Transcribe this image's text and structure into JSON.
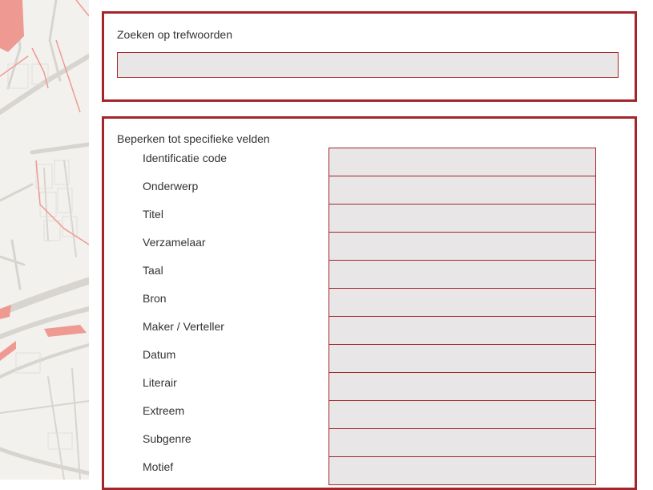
{
  "keyword_search": {
    "title": "Zoeken op trefwoorden",
    "value": ""
  },
  "field_search": {
    "title": "Beperken tot specifieke velden",
    "fields": [
      {
        "label": "Identificatie code",
        "value": ""
      },
      {
        "label": "Onderwerp",
        "value": ""
      },
      {
        "label": "Titel",
        "value": ""
      },
      {
        "label": "Verzamelaar",
        "value": ""
      },
      {
        "label": "Taal",
        "value": ""
      },
      {
        "label": "Bron",
        "value": ""
      },
      {
        "label": "Maker / Verteller",
        "value": ""
      },
      {
        "label": "Datum",
        "value": ""
      },
      {
        "label": "Literair",
        "value": ""
      },
      {
        "label": "Extreem",
        "value": ""
      },
      {
        "label": "Subgenre",
        "value": ""
      },
      {
        "label": "Motief",
        "value": ""
      }
    ]
  },
  "colors": {
    "accent": "#a3262a",
    "input_background": "#e8e6e6",
    "map_background": "#f3f1ee",
    "map_road": "#d8d5d0",
    "map_highlight": "#ee9a93"
  }
}
